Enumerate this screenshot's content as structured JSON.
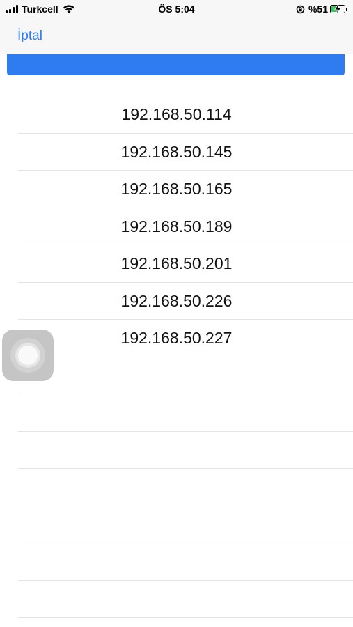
{
  "status_bar": {
    "carrier": "Turkcell",
    "time": "ÖS 5:04",
    "battery_percent": "%51",
    "battery_level": 0.51,
    "charging": true,
    "icons": [
      "signal-icon",
      "wifi-icon",
      "orientation-lock-icon",
      "battery-icon",
      "charging-bolt-icon"
    ]
  },
  "nav": {
    "cancel_label": "İptal"
  },
  "header_band": {
    "color": "#2f7bf0"
  },
  "ip_list": {
    "items": [
      "192.168.50.114",
      "192.168.50.145",
      "192.168.50.165",
      "192.168.50.189",
      "192.168.50.201",
      "192.168.50.226",
      "192.168.50.227",
      "",
      "",
      "",
      "",
      "",
      "",
      ""
    ]
  },
  "colors": {
    "accent": "#2f7cf6",
    "separator": "#e3e3e6",
    "battery_fill": "#35c759"
  }
}
